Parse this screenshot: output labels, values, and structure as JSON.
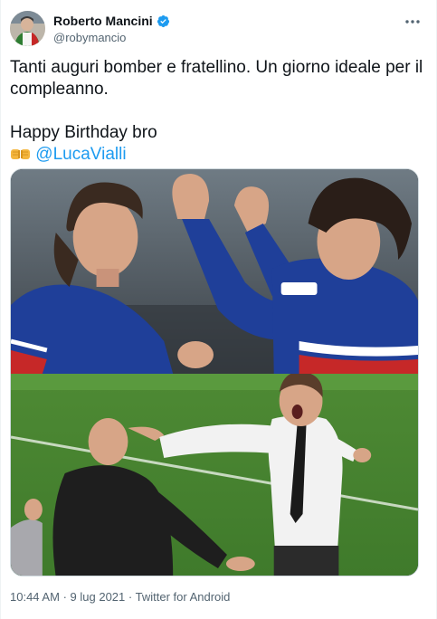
{
  "author": {
    "display_name": "Roberto Mancini",
    "handle": "@robymancio",
    "verified": true,
    "verified_color": "#1d9bf0"
  },
  "tweet": {
    "line1": "Tanti auguri bomber e fratellino. Un giorno ideale per il compleanno.",
    "line2": "Happy Birthday bro",
    "emojis": [
      "left-facing-fist-icon",
      "right-facing-fist-icon"
    ],
    "mention": "@LucaVialli",
    "mention_color": "#1d9bf0"
  },
  "meta": {
    "time": "10:44 AM",
    "separator": "·",
    "date": "9 lug 2021",
    "client": "Twitter for Android"
  },
  "menu": {
    "more_icon": "more-horizontal-icon"
  }
}
